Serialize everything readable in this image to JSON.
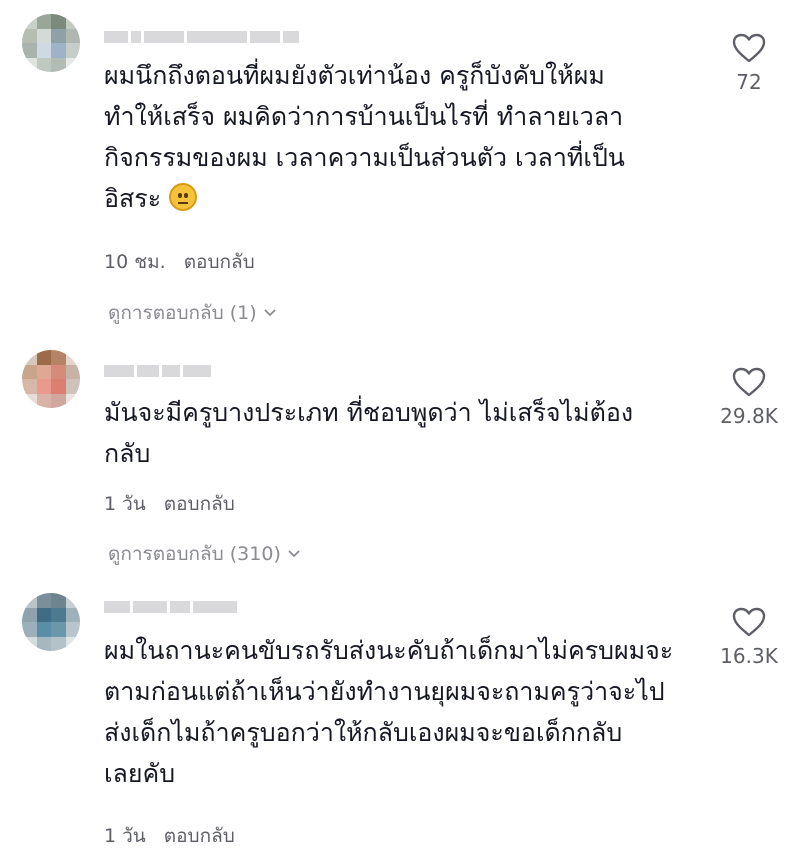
{
  "comments": [
    {
      "text_lines": [
        "ผมนึกถึงตอนที่ผมยังตัวเท่าน้อง ครูก็บังคับให้ผม",
        "ทำให้เสร็จ ผมคิดว่าการบ้านเป็นไรที่ ทำลายเวลา",
        "กิจกรรมของผม เวลาความเป็นส่วนตัว เวลาที่เป็น",
        "อิสระ"
      ],
      "emoji": "neutral-face-emoji",
      "time": "10 ชม.",
      "reply": "ตอบกลับ",
      "view_replies": "ดูการตอบกลับ (1)",
      "likes": "72"
    },
    {
      "text_lines": [
        "มันจะมีครูบางประเภท ที่ชอบพูดว่า ไม่เสร็จไม่ต้อง",
        "กลับ"
      ],
      "time": "1 วัน",
      "reply": "ตอบกลับ",
      "view_replies": "ดูการตอบกลับ (310)",
      "likes": "29.8K"
    },
    {
      "text_lines": [
        "ผมในถานะคนขับรถรับส่งนะคับถ้าเด็กมาไม่ครบผมจะ",
        "ตามก่อนแต่ถ้าเห็นว่ายังทำงานยุผมจะถามครูว่าจะไป",
        "ส่งเด็กไมถ้าครูบอกว่าให้กลับเองผมจะขอเด็กกลับ",
        "เลยคับ"
      ],
      "time": "1 วัน",
      "reply": "ตอบกลับ",
      "likes": "16.3K"
    }
  ],
  "icons": {
    "like": "heart-outline-icon",
    "expand": "chevron-down-icon"
  },
  "colors": {
    "text": "#161823",
    "muted": "#8a8b91",
    "secondary": "#5e5f66"
  }
}
